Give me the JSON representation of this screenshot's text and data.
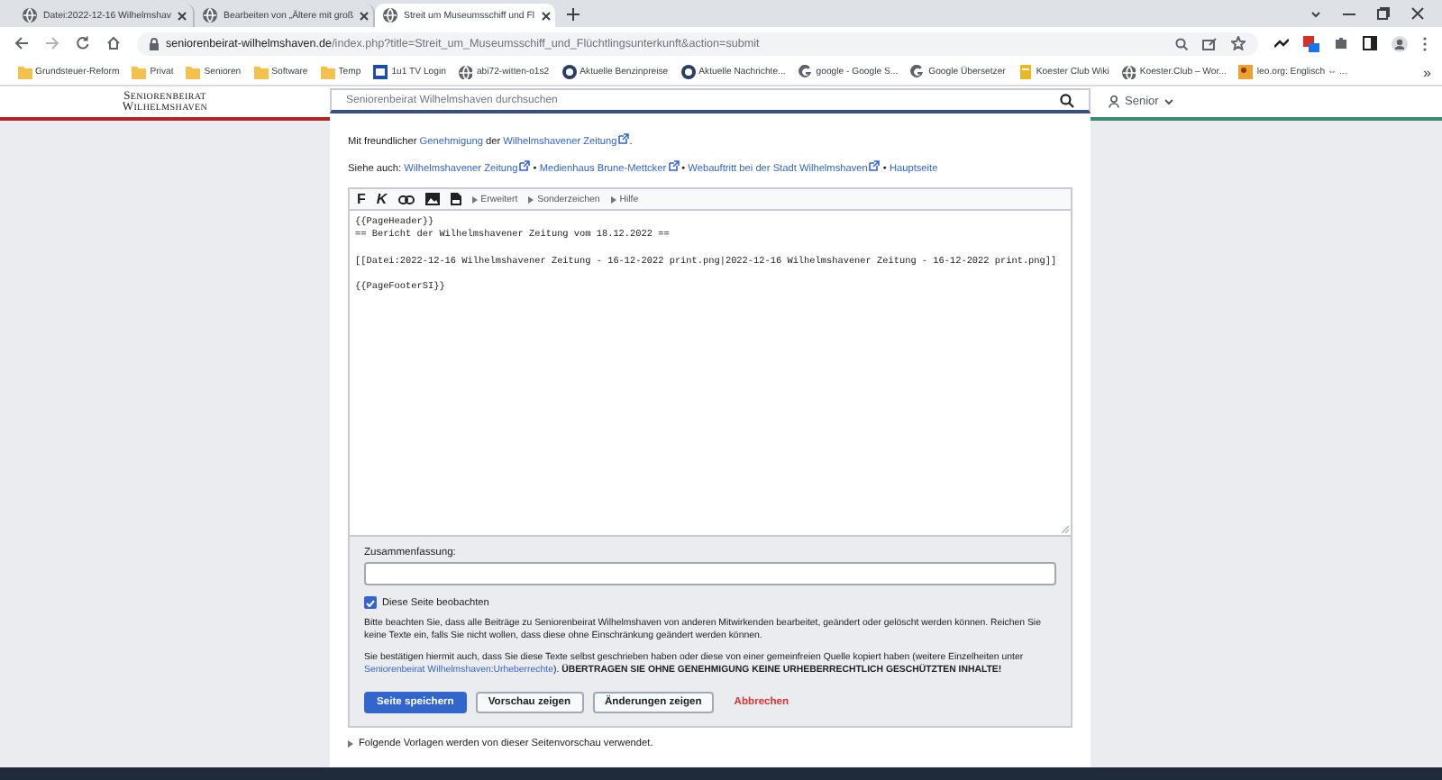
{
  "browser": {
    "tabs": [
      {
        "title": "Datei:2022-12-16 Wilhelmshav",
        "selected": false
      },
      {
        "title": "Bearbeiten von „Ältere mit groß",
        "selected": false
      },
      {
        "title": "Streit um Museumsschiff und Fl",
        "selected": true
      }
    ],
    "url_host": "seniorenbeirat-wilhelmshaven.de",
    "url_path": "/index.php?title=Streit_um_Museumsschiff_und_Flüchtlingsunterkunft&action=submit"
  },
  "bookmarks": [
    {
      "label": "Grundsteuer-Reform",
      "kind": "folder"
    },
    {
      "label": "Privat",
      "kind": "folder"
    },
    {
      "label": "Senioren",
      "kind": "folder"
    },
    {
      "label": "Software",
      "kind": "folder"
    },
    {
      "label": "Temp",
      "kind": "folder"
    },
    {
      "label": "1u1 TV Login",
      "kind": "tv"
    },
    {
      "label": "abi72-witten-o1s2",
      "kind": "globe"
    },
    {
      "label": "Aktuelle Benzinpreise",
      "kind": "round"
    },
    {
      "label": "Aktuelle Nachrichte...",
      "kind": "round"
    },
    {
      "label": "google - Google S...",
      "kind": "google"
    },
    {
      "label": "Google Übersetzer",
      "kind": "google"
    },
    {
      "label": "Koester Club Wiki",
      "kind": "wiki"
    },
    {
      "label": "Koester.Club – Wor...",
      "kind": "globe"
    },
    {
      "label": "leo.org: Englisch ⇔ ...",
      "kind": "leo"
    }
  ],
  "bookmarks_more": "»",
  "site": {
    "logo_line1": "Seniorenbeirat",
    "logo_line2": "Wilhelmshaven",
    "search_placeholder": "Seniorenbeirat Wilhelmshaven durchsuchen",
    "user": "Senior"
  },
  "permission": [
    {
      "kind": "text",
      "text": "Mit freundlicher "
    },
    {
      "kind": "link",
      "text": "Genehmigung"
    },
    {
      "kind": "text",
      "text": " der "
    },
    {
      "kind": "external",
      "text": "Wilhelmshavener Zeitung"
    },
    {
      "kind": "text",
      "text": "."
    }
  ],
  "see_also": [
    {
      "kind": "text",
      "text": "Siehe auch: "
    },
    {
      "kind": "external",
      "text": "Wilhelmshavener Zeitung"
    },
    {
      "kind": "separator",
      "text": " • "
    },
    {
      "kind": "external",
      "text": "Medienhaus Brune-Mettcker"
    },
    {
      "kind": "separator",
      "text": " • "
    },
    {
      "kind": "external",
      "text": "Webauftritt bei der Stadt Wilhelmshaven"
    },
    {
      "kind": "separator",
      "text": " • "
    },
    {
      "kind": "link",
      "text": "Hauptseite"
    }
  ],
  "toolbar": {
    "bold": "F",
    "italic": "K",
    "menus": [
      "Erweitert",
      "Sonderzeichen",
      "Hilfe"
    ]
  },
  "wikitext": "{{PageHeader}}\n== Bericht der Wilhelmshavener Zeitung vom 18.12.2022 ==\n\n[[Datei:2022-12-16 Wilhelmshavener Zeitung - 16-12-2022 print.png|2022-12-16 Wilhelmshavener Zeitung - 16-12-2022 print.png]]\n\n{{PageFooterSI}}",
  "summary_label": "Zusammenfassung:",
  "watch": {
    "label": "Diese Seite beobachten",
    "checked": true
  },
  "notice": "Bitte beachten Sie, dass alle Beiträge zu Seniorenbeirat Wilhelmshaven von anderen Mitwirkenden bearbeitet, geändert oder gelöscht werden können. Reichen Sie keine Texte ein, falls Sie nicht wollen, dass diese ohne Einschränkung geändert werden können.",
  "copyright": [
    {
      "kind": "text",
      "text": "Sie bestätigen hiermit auch, dass Sie diese Texte selbst geschrieben haben oder diese von einer gemeinfreien Quelle kopiert haben (weitere Einzelheiten unter "
    },
    {
      "kind": "link",
      "text": "Seniorenbeirat Wilhelmshaven:Urheberrechte"
    },
    {
      "kind": "text",
      "text": "). "
    },
    {
      "kind": "strong",
      "text": "ÜBERTRAGEN SIE OHNE GENEHMIGUNG KEINE URHEBERRECHTLICH GESCHÜTZTEN INHALTE!"
    }
  ],
  "buttons": [
    {
      "label": "Seite speichern",
      "kind": "primary"
    },
    {
      "label": "Vorschau zeigen",
      "kind": "normal"
    },
    {
      "label": "Änderungen zeigen",
      "kind": "normal"
    },
    {
      "label": "Abbrechen",
      "kind": "destructive"
    }
  ],
  "templates_note": "Folgende Vorlagen werden von dieser Seitenvorschau verwendet."
}
